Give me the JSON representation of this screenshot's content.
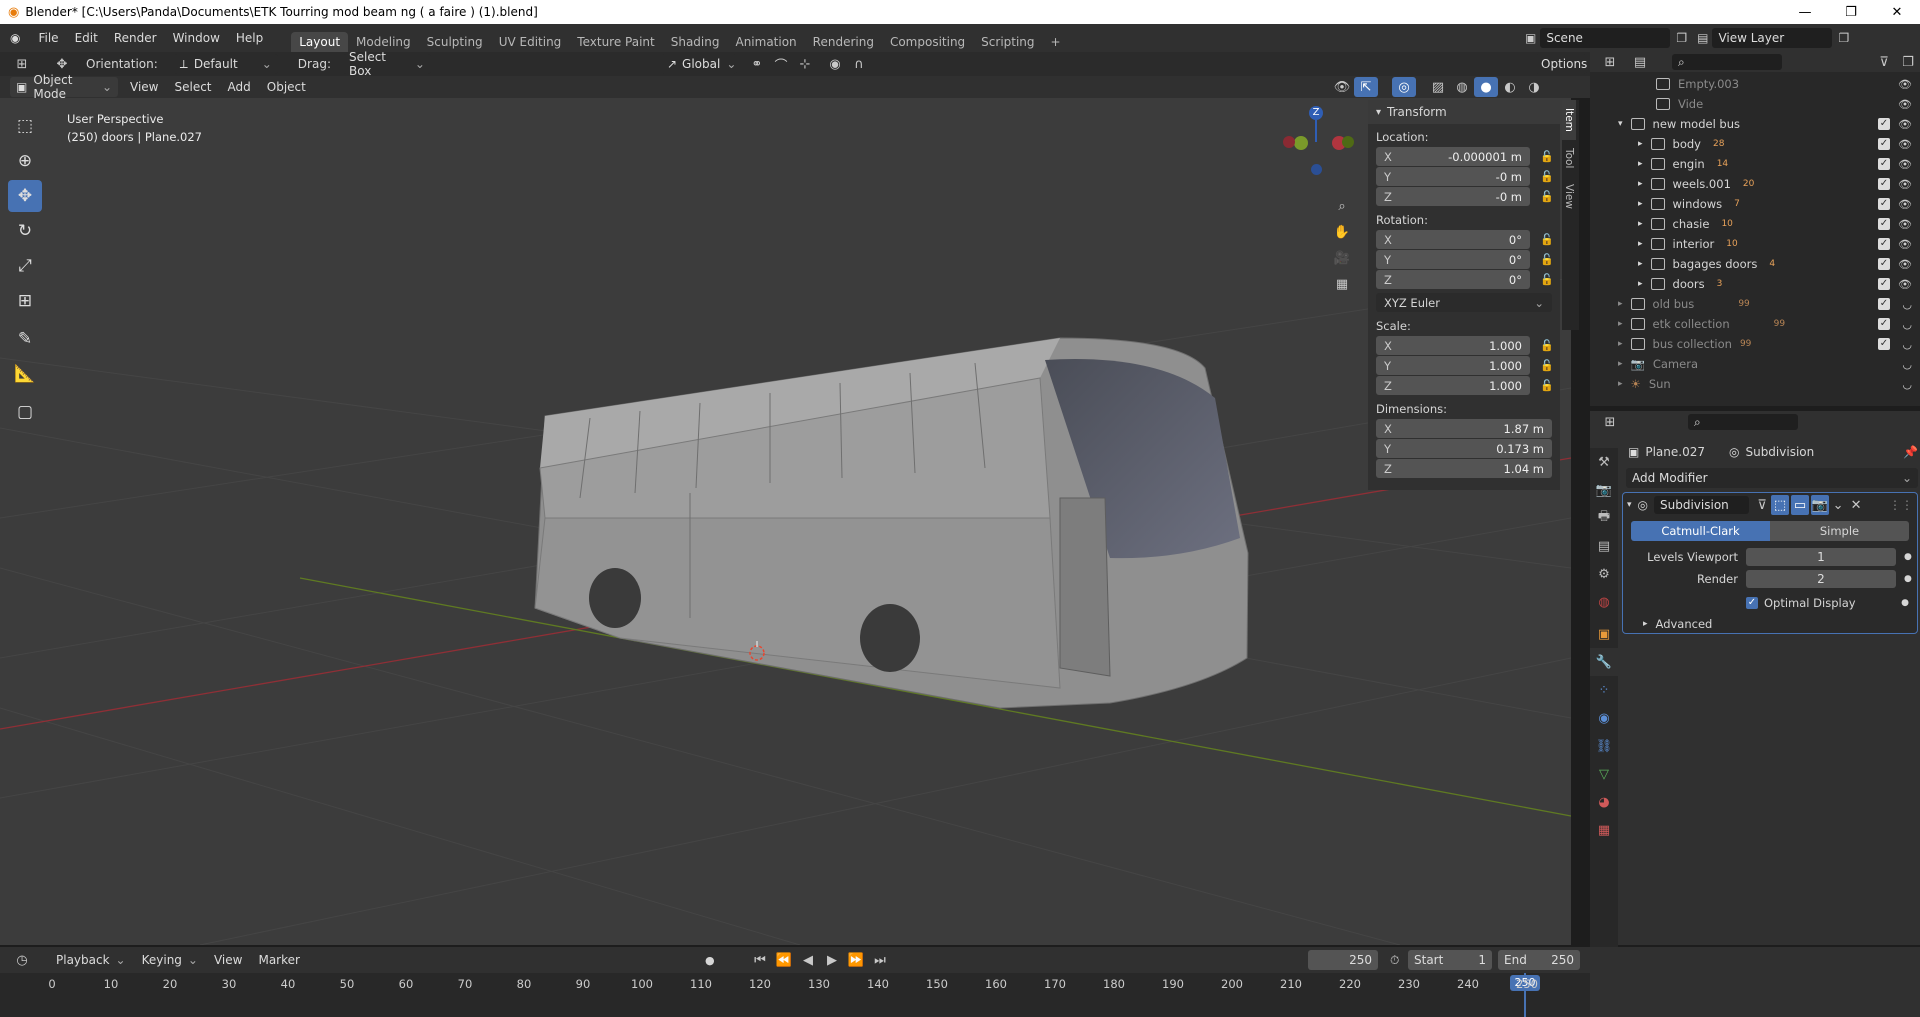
{
  "window": {
    "title": "Blender* [C:\\Users\\Panda\\Documents\\ETK Tourring mod beam ng ( a faire ) (1).blend]"
  },
  "menu": [
    "File",
    "Edit",
    "Render",
    "Window",
    "Help"
  ],
  "workspaces": [
    "Layout",
    "Modeling",
    "Sculpting",
    "UV Editing",
    "Texture Paint",
    "Shading",
    "Animation",
    "Rendering",
    "Compositing",
    "Scripting"
  ],
  "scene": {
    "label": "Scene",
    "view_layer": "View Layer"
  },
  "tool_header": {
    "orientation_label": "Orientation:",
    "orientation_value": "Default",
    "drag_label": "Drag:",
    "drag_value": "Select Box",
    "transform_space": "Global",
    "options": "Options"
  },
  "viewport_header": {
    "mode": "Object Mode",
    "menus": [
      "View",
      "Select",
      "Add",
      "Object"
    ]
  },
  "viewport": {
    "perspective": "User Perspective",
    "selection_info": "(250) doors | Plane.027",
    "gizmo_z": "Z"
  },
  "n_panel": {
    "title": "Transform",
    "location_label": "Location:",
    "location": {
      "x": "-0.000001 m",
      "y": "-0 m",
      "z": "-0 m"
    },
    "rotation_label": "Rotation:",
    "rotation": {
      "x": "0°",
      "y": "0°",
      "z": "0°"
    },
    "rotation_mode": "XYZ Euler",
    "scale_label": "Scale:",
    "scale": {
      "x": "1.000",
      "y": "1.000",
      "z": "1.000"
    },
    "dimensions_label": "Dimensions:",
    "dimensions": {
      "x": "1.87 m",
      "y": "0.173 m",
      "z": "1.04 m"
    },
    "axes": {
      "x": "X",
      "y": "Y",
      "z": "Z"
    },
    "tabs": [
      "Item",
      "Tool",
      "View"
    ]
  },
  "outliner": {
    "rows": [
      {
        "name": "Empty.003",
        "dim": true
      },
      {
        "name": "Vide",
        "dim": true
      },
      {
        "name": "new model bus",
        "dim": false
      },
      {
        "name": "body",
        "badge": "28",
        "dim": false
      },
      {
        "name": "engin",
        "badge": "14",
        "dim": false
      },
      {
        "name": "weels.001",
        "badge": "20",
        "dim": false
      },
      {
        "name": "windows",
        "badge": "7",
        "dim": false
      },
      {
        "name": "chasie",
        "badge": "10",
        "dim": false
      },
      {
        "name": "interior",
        "badge": "10",
        "dim": false
      },
      {
        "name": "bagages doors",
        "badge": "4",
        "dim": false
      },
      {
        "name": "doors",
        "badge": "3",
        "dim": false
      },
      {
        "name": "old bus",
        "badge": "99",
        "dim": true
      },
      {
        "name": "etk collection",
        "badge": "99",
        "dim": true
      },
      {
        "name": "bus collection",
        "badge": "99",
        "dim": true
      },
      {
        "name": "Camera",
        "dim": true
      },
      {
        "name": "Sun",
        "dim": true
      }
    ]
  },
  "properties": {
    "object": "Plane.027",
    "modifier_context": "Subdivision",
    "add_modifier": "Add Modifier",
    "modifier_name": "Subdivision",
    "type_catmull": "Catmull-Clark",
    "type_simple": "Simple",
    "levels_viewport_label": "Levels Viewport",
    "levels_viewport": "1",
    "render_label": "Render",
    "render": "2",
    "optimal_display": "Optimal Display",
    "advanced": "Advanced"
  },
  "timeline": {
    "menus": [
      "Playback",
      "Keying",
      "View",
      "Marker"
    ],
    "current_frame": "250",
    "start_label": "Start",
    "start": "1",
    "end_label": "End",
    "end": "250",
    "ticks": [
      "0",
      "10",
      "20",
      "30",
      "40",
      "50",
      "60",
      "70",
      "80",
      "90",
      "100",
      "110",
      "120",
      "130",
      "140",
      "150",
      "160",
      "170",
      "180",
      "190",
      "200",
      "210",
      "220",
      "230",
      "240",
      "250"
    ]
  },
  "colors": {
    "accent": "#4772b3",
    "x_axis": "#b0353f",
    "y_axis": "#7a9a2a",
    "z_axis": "#2f5eb5"
  }
}
